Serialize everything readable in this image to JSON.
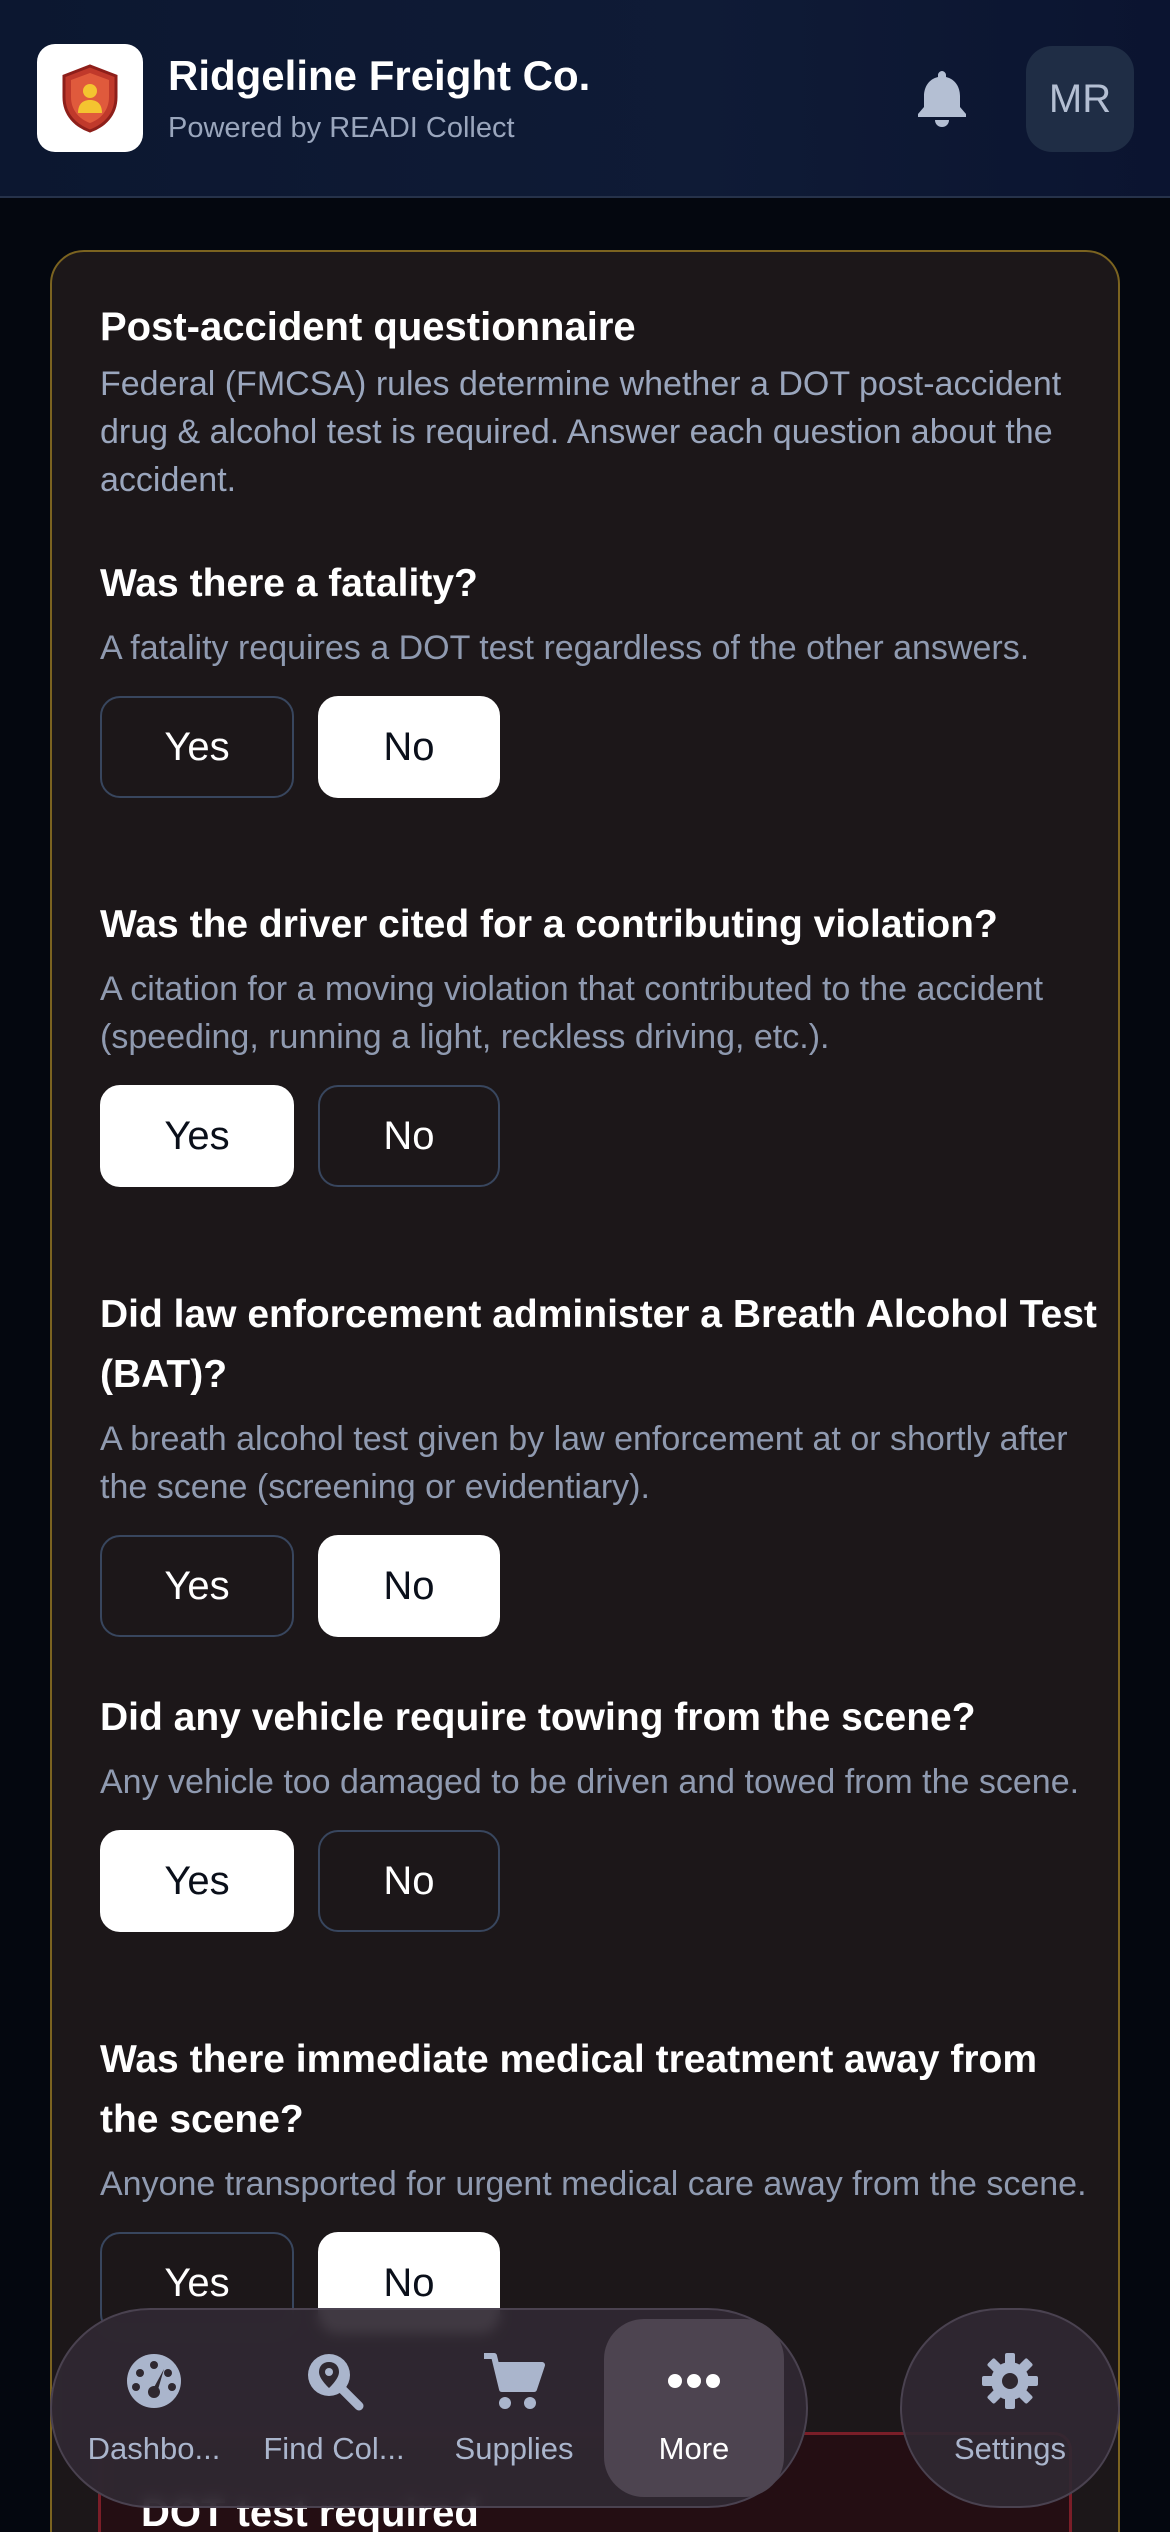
{
  "header": {
    "company_name": "Ridgeline Freight Co.",
    "powered_by": "Powered by READI Collect",
    "avatar_initials": "MR",
    "logo_icon": "shield-person-icon",
    "bell_icon": "bell-icon"
  },
  "questionnaire": {
    "title": "Post-accident questionnaire",
    "intro": "Federal (FMCSA) rules determine whether a DOT post-accident drug & alcohol test is required. Answer each question about the accident.",
    "yes_label": "Yes",
    "no_label": "No",
    "questions": [
      {
        "text": "Was there a fatality?",
        "help": "A fatality requires a DOT test regardless of the other answers.",
        "answer": "No"
      },
      {
        "text": "Was the driver cited for a contributing violation?",
        "help": "A citation for a moving violation that contributed to the accident (speeding, running a light, reckless driving, etc.).",
        "answer": "Yes"
      },
      {
        "text": "Did law enforcement administer a Breath Alcohol Test (BAT)?",
        "help": "A breath alcohol test given by law enforcement at or shortly after the scene (screening or evidentiary).",
        "answer": "No"
      },
      {
        "text": "Did any vehicle require towing from the scene?",
        "help": "Any vehicle too damaged to be driven and towed from the scene.",
        "answer": "Yes"
      },
      {
        "text": "Was there immediate medical treatment away from the scene?",
        "help": "Anyone transported for urgent medical care away from the scene.",
        "answer": "No"
      }
    ]
  },
  "result_banner": {
    "text": "DOT test required"
  },
  "nav": {
    "items": [
      {
        "label": "Dashbo...",
        "icon": "gauge-icon"
      },
      {
        "label": "Find Col...",
        "icon": "search-location-icon"
      },
      {
        "label": "Supplies",
        "icon": "cart-icon"
      },
      {
        "label": "More",
        "icon": "more-dots-icon",
        "active": true
      }
    ],
    "settings_label": "Settings",
    "settings_icon": "gear-icon"
  },
  "colors": {
    "background": "#04070f",
    "header": "#0f1b36",
    "card": "#1c1719",
    "card_border": "#7b6320",
    "muted_text": "#9aa6bd",
    "selected_button": "#ffffff",
    "danger_border": "#7a1e28"
  }
}
